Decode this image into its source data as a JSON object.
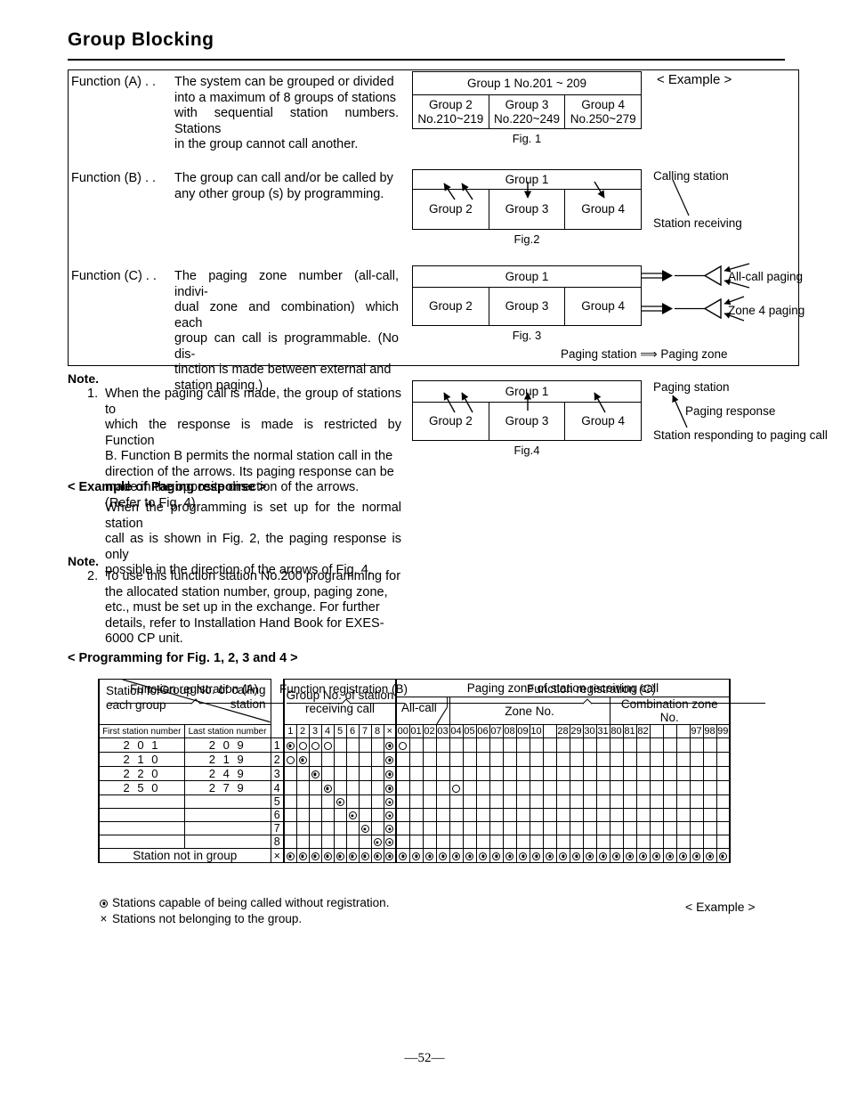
{
  "page": {
    "title": "Group Blocking",
    "footer": "—52—"
  },
  "functions": [
    {
      "label": "Function (A) . .",
      "lines": [
        "The system can be grouped or divided",
        "into a maximum of 8 groups of stations",
        "with sequential station numbers. Stations",
        "in the group cannot call another."
      ]
    },
    {
      "label": "Function (B) . .",
      "lines": [
        "The group can call and/or be called by",
        "any other group (s) by programming."
      ]
    },
    {
      "label": "Function (C) . .",
      "lines": [
        "The paging zone number (all-call, indivi-",
        "dual zone and combination) which each",
        "group can call is programmable. (No dis-",
        "tinction is made between external and",
        "station paging.)"
      ]
    }
  ],
  "example_label_top": "< Example >",
  "fig1": {
    "caption": "Fig. 1",
    "top": "Group 1      No.201 ~ 209",
    "cells": [
      {
        "name": "Group 2",
        "range": "No.210~219"
      },
      {
        "name": "Group 3",
        "range": "No.220~249"
      },
      {
        "name": "Group 4",
        "range": "No.250~279"
      }
    ]
  },
  "fig2": {
    "caption": "Fig.2",
    "top": "Group 1",
    "cells": [
      "Group 2",
      "Group 3",
      "Group 4"
    ],
    "annotations": [
      "Calling station",
      "Station receiving"
    ]
  },
  "fig3": {
    "caption": "Fig. 3",
    "top": "Group 1",
    "cells": [
      "Group 2",
      "Group 3",
      "Group 4"
    ],
    "annotations": [
      "All-call paging",
      "Zone 4 paging"
    ],
    "legend": "Paging station ⟹  Paging zone"
  },
  "fig4": {
    "caption": "Fig.4",
    "top": "Group 1",
    "cells": [
      "Group 2",
      "Group 3",
      "Group 4"
    ],
    "annotations": [
      "Paging station",
      "Paging response",
      "Station responding to paging call"
    ]
  },
  "note1": {
    "head": "Note.",
    "number": "1.",
    "lines": [
      "When the paging call is made, the group of stations to",
      "which the response is made is restricted by Function",
      "B. Function B permits the normal station call in the",
      "direction of the arrows. Its paging response can be",
      "made in the opposite direction of the arrows.",
      "(Refer to Fig. 4)"
    ]
  },
  "example_paging": {
    "head": "< Example of Paging response >",
    "lines": [
      "When the programming is set up for the normal station",
      "call as is shown in Fig. 2, the paging response is only",
      "possible in the direction of the arrows of Fig. 4."
    ]
  },
  "note2": {
    "head": "Note.",
    "number": "2.",
    "lines": [
      "To use this function station No.200 programming for",
      "the allocated station number, group, paging zone,",
      "etc., must be set up in the exchange. For further",
      "details, refer to Installation Hand Book for EXES-",
      "6000 CP unit."
    ]
  },
  "programming": {
    "head": "< Programming for Fig. 1, 2, 3 and 4 >",
    "registration_labels": [
      "Function registration (A)",
      "Function registration (B)",
      "Function registration (C)"
    ],
    "headers": {
      "station_for_each_group": "Station for\neach group",
      "group_no_calling_station": "Group No. of calling\nstation",
      "group_no_receiving": "Group No. of station\nreceiving call",
      "paging_zone": "Paging zone of station receiving call",
      "all_call": "All-call",
      "zone_no": "Zone No.",
      "combination_zone_no": "Combination zone No.",
      "first_station_number": "First station number",
      "last_station_number": "Last station number",
      "station_not_in_group": "Station not in group"
    },
    "group_cols": [
      "1",
      "2",
      "3",
      "4",
      "5",
      "6",
      "7",
      "8",
      "×"
    ],
    "zone_cols": [
      "00",
      "01",
      "02",
      "03",
      "04",
      "05",
      "06",
      "07",
      "08",
      "09",
      "10",
      "",
      "28",
      "29",
      "30",
      "31",
      "80",
      "81",
      "82",
      "",
      "",
      "",
      "97",
      "98",
      "99"
    ],
    "rows": [
      {
        "label": "1",
        "first": "2 0 1",
        "last": "2 0 9",
        "groups": [
          "dot",
          "open",
          "open",
          "open",
          "",
          "",
          "",
          "",
          "dot"
        ],
        "zones": [
          "open",
          "",
          "",
          "",
          "",
          "",
          "",
          "",
          "",
          "",
          "",
          "",
          "",
          "",
          "",
          "",
          "",
          "",
          "",
          "",
          "",
          "",
          "",
          "",
          ""
        ]
      },
      {
        "label": "2",
        "first": "2 1 0",
        "last": "2 1 9",
        "groups": [
          "open",
          "dot",
          "",
          "",
          "",
          "",
          "",
          "",
          "dot"
        ],
        "zones": [
          "",
          "",
          "",
          "",
          "",
          "",
          "",
          "",
          "",
          "",
          "",
          "",
          "",
          "",
          "",
          "",
          "",
          "",
          "",
          "",
          "",
          "",
          "",
          "",
          ""
        ]
      },
      {
        "label": "3",
        "first": "2 2 0",
        "last": "2 4 9",
        "groups": [
          "",
          "",
          "dot",
          "",
          "",
          "",
          "",
          "",
          "dot"
        ],
        "zones": [
          "",
          "",
          "",
          "",
          "",
          "",
          "",
          "",
          "",
          "",
          "",
          "",
          "",
          "",
          "",
          "",
          "",
          "",
          "",
          "",
          "",
          "",
          "",
          "",
          ""
        ]
      },
      {
        "label": "4",
        "first": "2 5 0",
        "last": "2 7 9",
        "groups": [
          "",
          "",
          "",
          "dot",
          "",
          "",
          "",
          "",
          "dot"
        ],
        "zones": [
          "",
          "",
          "",
          "",
          "open",
          "",
          "",
          "",
          "",
          "",
          "",
          "",
          "",
          "",
          "",
          "",
          "",
          "",
          "",
          "",
          "",
          "",
          "",
          "",
          ""
        ]
      },
      {
        "label": "5",
        "first": "",
        "last": "",
        "groups": [
          "",
          "",
          "",
          "",
          "dot",
          "",
          "",
          "",
          "dot"
        ],
        "zones": [
          "",
          "",
          "",
          "",
          "",
          "",
          "",
          "",
          "",
          "",
          "",
          "",
          "",
          "",
          "",
          "",
          "",
          "",
          "",
          "",
          "",
          "",
          "",
          "",
          ""
        ]
      },
      {
        "label": "6",
        "first": "",
        "last": "",
        "groups": [
          "",
          "",
          "",
          "",
          "",
          "dot",
          "",
          "",
          "dot"
        ],
        "zones": [
          "",
          "",
          "",
          "",
          "",
          "",
          "",
          "",
          "",
          "",
          "",
          "",
          "",
          "",
          "",
          "",
          "",
          "",
          "",
          "",
          "",
          "",
          "",
          "",
          ""
        ]
      },
      {
        "label": "7",
        "first": "",
        "last": "",
        "groups": [
          "",
          "",
          "",
          "",
          "",
          "",
          "dot",
          "",
          "dot"
        ],
        "zones": [
          "",
          "",
          "",
          "",
          "",
          "",
          "",
          "",
          "",
          "",
          "",
          "",
          "",
          "",
          "",
          "",
          "",
          "",
          "",
          "",
          "",
          "",
          "",
          "",
          ""
        ]
      },
      {
        "label": "8",
        "first": "",
        "last": "",
        "groups": [
          "",
          "",
          "",
          "",
          "",
          "",
          "",
          "dot",
          "dot"
        ],
        "zones": [
          "",
          "",
          "",
          "",
          "",
          "",
          "",
          "",
          "",
          "",
          "",
          "",
          "",
          "",
          "",
          "",
          "",
          "",
          "",
          "",
          "",
          "",
          "",
          "",
          ""
        ]
      }
    ],
    "last_row": {
      "label": "×",
      "text": "Station not in group",
      "groups": [
        "dot",
        "dot",
        "dot",
        "dot",
        "dot",
        "dot",
        "dot",
        "dot",
        "dot"
      ],
      "zones": [
        "dot",
        "dot",
        "dot",
        "dot",
        "dot",
        "dot",
        "dot",
        "dot",
        "dot",
        "dot",
        "dot",
        "dot",
        "dot",
        "dot",
        "dot",
        "dot",
        "dot",
        "dot",
        "dot",
        "dot",
        "dot",
        "dot",
        "dot",
        "dot",
        "dot"
      ]
    },
    "legend": [
      "Stations capable of being called without registration.",
      "Stations not belonging to the group."
    ],
    "example_label": "< Example >"
  }
}
